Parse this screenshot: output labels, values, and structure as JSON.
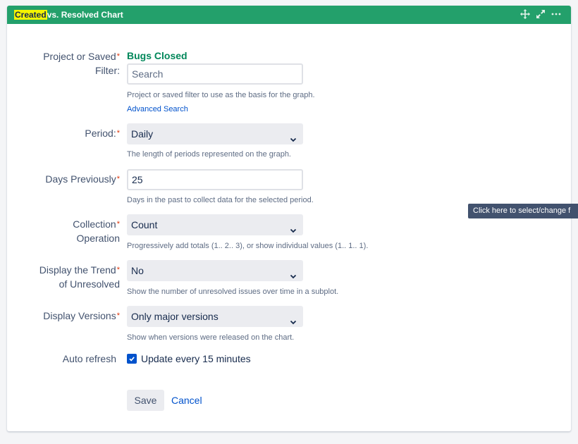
{
  "gadget": {
    "title_highlight": "Created",
    "title_rest": "vs. Resolved Chart",
    "icons": [
      "move-icon",
      "expand-icon",
      "more-icon"
    ],
    "header_color": "#23a06b"
  },
  "form": {
    "filter": {
      "label_line1": "Project or Saved",
      "label_line2": "Filter:",
      "selected_name": "Bugs Closed",
      "placeholder": "Search",
      "value": "",
      "help": "Project or saved filter to use as the basis for the graph.",
      "advanced_link": "Advanced Search"
    },
    "period": {
      "label": "Period:",
      "value": "Daily",
      "help": "The length of periods represented on the graph."
    },
    "days_previously": {
      "label": "Days Previously",
      "value": "25",
      "help": "Days in the past to collect data for the selected period."
    },
    "collection_operation": {
      "label_line1": "Collection",
      "label_line2": "Operation",
      "value": "Count",
      "help": "Progressively add totals (1.. 2.. 3), or show individual values (1.. 1.. 1)."
    },
    "trend": {
      "label_line1": "Display the Trend",
      "label_line2": "of Unresolved",
      "value": "No",
      "help": "Show the number of unresolved issues over time in a subplot."
    },
    "versions": {
      "label": "Display Versions",
      "value": "Only major versions",
      "help": "Show when versions were released on the chart."
    },
    "auto_refresh": {
      "label": "Auto refresh",
      "checkbox_label": "Update every 15 minutes",
      "checked": true
    },
    "required_mark": "*",
    "save_label": "Save",
    "cancel_label": "Cancel"
  },
  "tooltip": {
    "text": "Click here to select/change f"
  }
}
